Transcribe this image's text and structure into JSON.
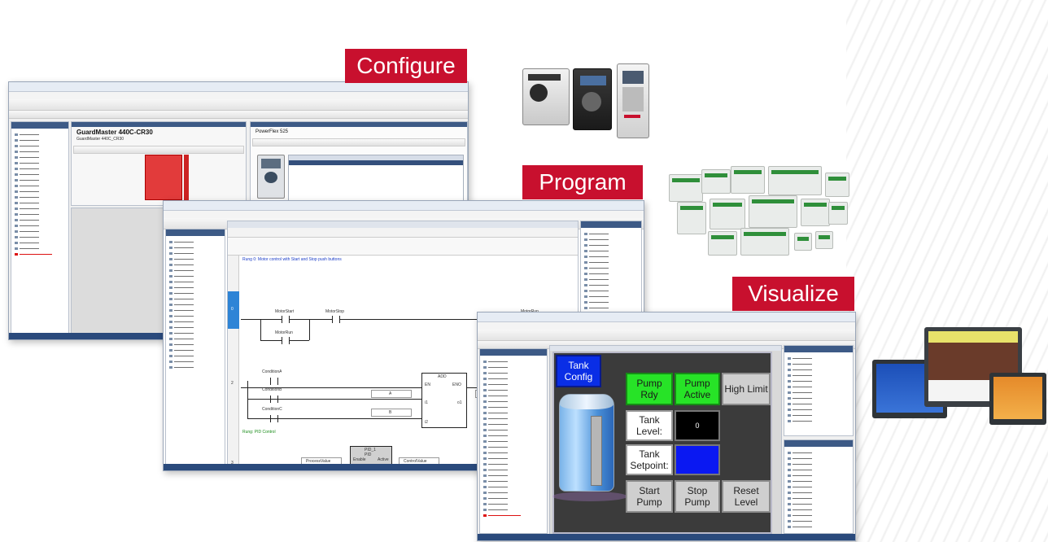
{
  "labels": {
    "configure": "Configure",
    "program": "Program",
    "visualize": "Visualize"
  },
  "configure_window": {
    "device_title": "GuardMaster 440C-CR30",
    "device_subtitle": "GuardMaster 440C_CR30",
    "right_pane_title": "PowerFlex 525"
  },
  "program_window": {
    "rung_comment_1": "Rung 0: Motor control with Start and Stop push buttons",
    "rung_0_number": "0",
    "rung_2_number": "2",
    "rung_3_number": "3",
    "motor_start": "MotorStart",
    "motor_stop": "MotorStop",
    "motor_run": "MotorRun",
    "motor_run_seal": "MotorRun",
    "condition_a": "ConditionA",
    "condition_b": "ConditionB",
    "condition_c": "ConditionC",
    "add_block": "ADD",
    "add_en": "EN",
    "add_eno": "ENO",
    "add_i1": "i1",
    "add_i2": "i2",
    "add_o1": "o1",
    "add_a": "A",
    "add_b": "B",
    "add_c": "C",
    "rung_comment_2": "Rung: PID Control",
    "pid_block": "PID_1\nPID",
    "pid_enable": "Enable",
    "pid_active": "Active",
    "process_value": "ProcessValue",
    "control_value": "ControlValue"
  },
  "hmi": {
    "tank_config": "Tank\nConfig",
    "pump_rdy": "Pump Rdy",
    "pump_active": "Pump\nActive",
    "high_limit": "High Limit",
    "tank_level": "Tank\nLevel:",
    "tank_level_value": "0",
    "tank_setpoint": "Tank\nSetpoint:",
    "start_pump": "Start\nPump",
    "stop_pump": "Stop\nPump",
    "reset_level": "Reset\nLevel"
  },
  "colors": {
    "label_red": "#c8102e",
    "hmi_green": "#27e327",
    "hmi_blue": "#0a18f2",
    "hmi_background": "#3b3b3b"
  }
}
